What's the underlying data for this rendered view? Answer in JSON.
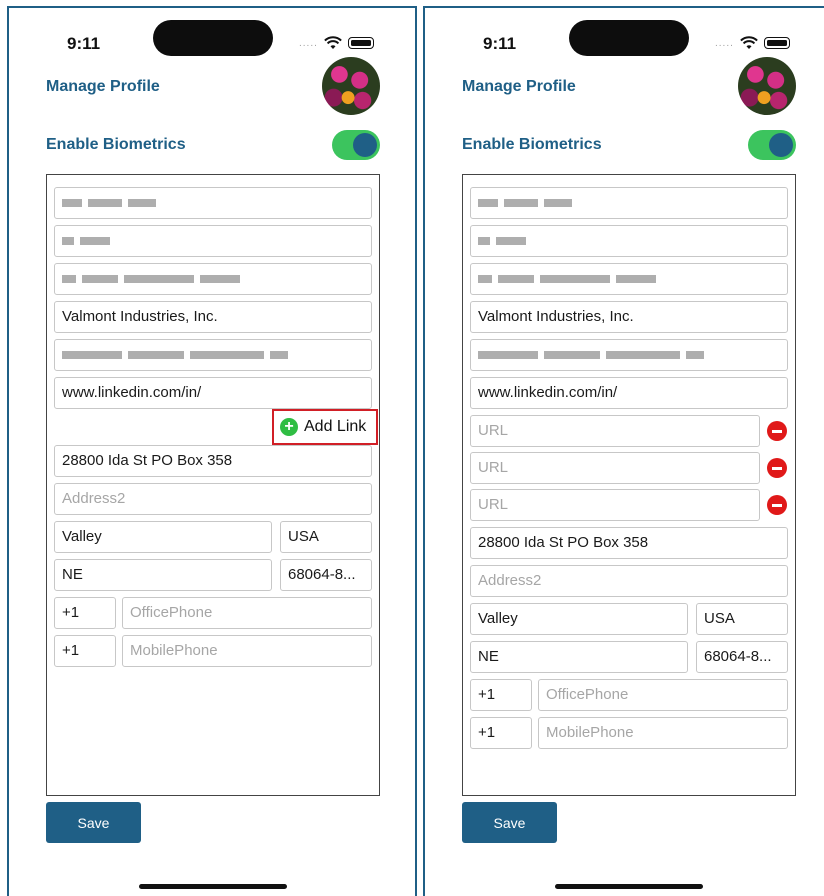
{
  "status": {
    "time": "9:11",
    "dots": "....."
  },
  "title": "Manage Profile",
  "biometrics_label": "Enable Biometrics",
  "biometrics_enabled": true,
  "fields": {
    "company": "Valmont Industries, Inc.",
    "linkedin": "www.linkedin.com/in/",
    "address1": "28800 Ida St PO Box 358",
    "address2_placeholder": "Address2",
    "city": "Valley",
    "country": "USA",
    "state": "NE",
    "zip": "68064-8...",
    "office_code": "+1",
    "office_placeholder": "OfficePhone",
    "mobile_code": "+1",
    "mobile_placeholder": "MobilePhone",
    "url_placeholder": "URL"
  },
  "add_link_label": "Add Link",
  "save_label": "Save",
  "colors": {
    "accent": "#1f5f86",
    "toggle_on": "#3cc45e",
    "highlight": "#d11f26",
    "remove": "#e01919"
  }
}
